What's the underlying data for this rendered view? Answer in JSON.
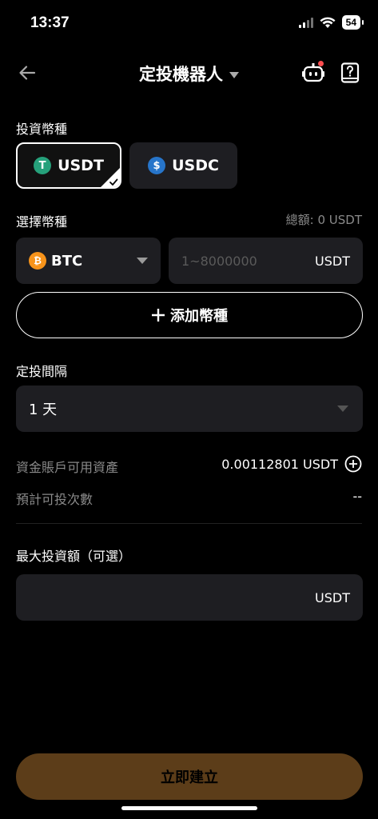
{
  "status": {
    "time": "13:37",
    "battery": "54"
  },
  "header": {
    "title": "定投機器人"
  },
  "invest_currency": {
    "label": "投資幣種",
    "options": [
      {
        "label": "USDT",
        "icon": "tether-icon",
        "color": "#26a17b",
        "selected": true
      },
      {
        "label": "USDC",
        "icon": "usdc-icon",
        "color": "#2775ca",
        "selected": false
      }
    ]
  },
  "select_currency": {
    "label": "選擇幣種",
    "total": "總額: 0 USDT",
    "coin": "BTC",
    "coin_color": "#f7931a",
    "amount_placeholder": "1~8000000",
    "amount_unit": "USDT"
  },
  "add_currency": {
    "label": "添加幣種"
  },
  "interval": {
    "label": "定投間隔",
    "value": "1 天"
  },
  "funds": {
    "available_label": "資金賬戶可用資產",
    "available_value": "0.00112801 USDT",
    "expected_label": "預計可投次數",
    "expected_value": "--"
  },
  "max_invest": {
    "label": "最大投資額（可選）",
    "unit": "USDT"
  },
  "submit": {
    "label": "立即建立"
  }
}
